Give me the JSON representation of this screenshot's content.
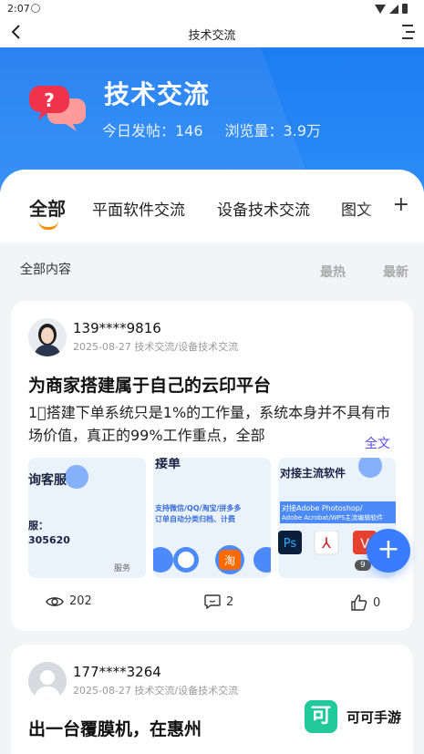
{
  "status": {
    "time": "2:07"
  },
  "nav": {
    "title": "技术交流"
  },
  "hero": {
    "title": "技术交流",
    "today_posts": "今日发帖：146",
    "views": "浏览量：3.9万"
  },
  "tabs": [
    "全部",
    "平面软件交流",
    "设备技术交流",
    "图文"
  ],
  "filters": {
    "all": "全部内容",
    "hot": "最热",
    "newest": "最新"
  },
  "posts": [
    {
      "user": "139****9816",
      "meta": "2025-08-27 技术交流/设备技术交流",
      "title": "为商家搭建属于自己的云印平台",
      "excerpt": "1⃣搭建下单系统只是1%的工作量，系统本身并不具有市场价值，真正的99%工作重点，全部",
      "more": "全文",
      "thumbs": [
        {
          "big": "询客服",
          "line1": "服：",
          "line2": "305620",
          "badge": "服务"
        },
        {
          "big": "接单",
          "line1": "支持微信/QQ/淘宝/拼多多",
          "line2": "订单自动分类归档、计费"
        },
        {
          "big": "对接主流软件",
          "line1": "对接Adobe Photoshop/",
          "line2": "Adobe Acrobat/WPS主流编辑软件",
          "badge": "9"
        }
      ],
      "views": "202",
      "comments": "2",
      "likes": "0"
    },
    {
      "user": "177****3264",
      "meta": "2025-08-27 技术交流/设备技术交流",
      "title": "出一台覆膜机，在惠州"
    }
  ],
  "watermark": {
    "logo": "可",
    "name": "可可手游"
  },
  "colors": {
    "accent": "#3a7cff",
    "hero": "#1e7cf2",
    "tab_underline": "#ff8a00"
  }
}
